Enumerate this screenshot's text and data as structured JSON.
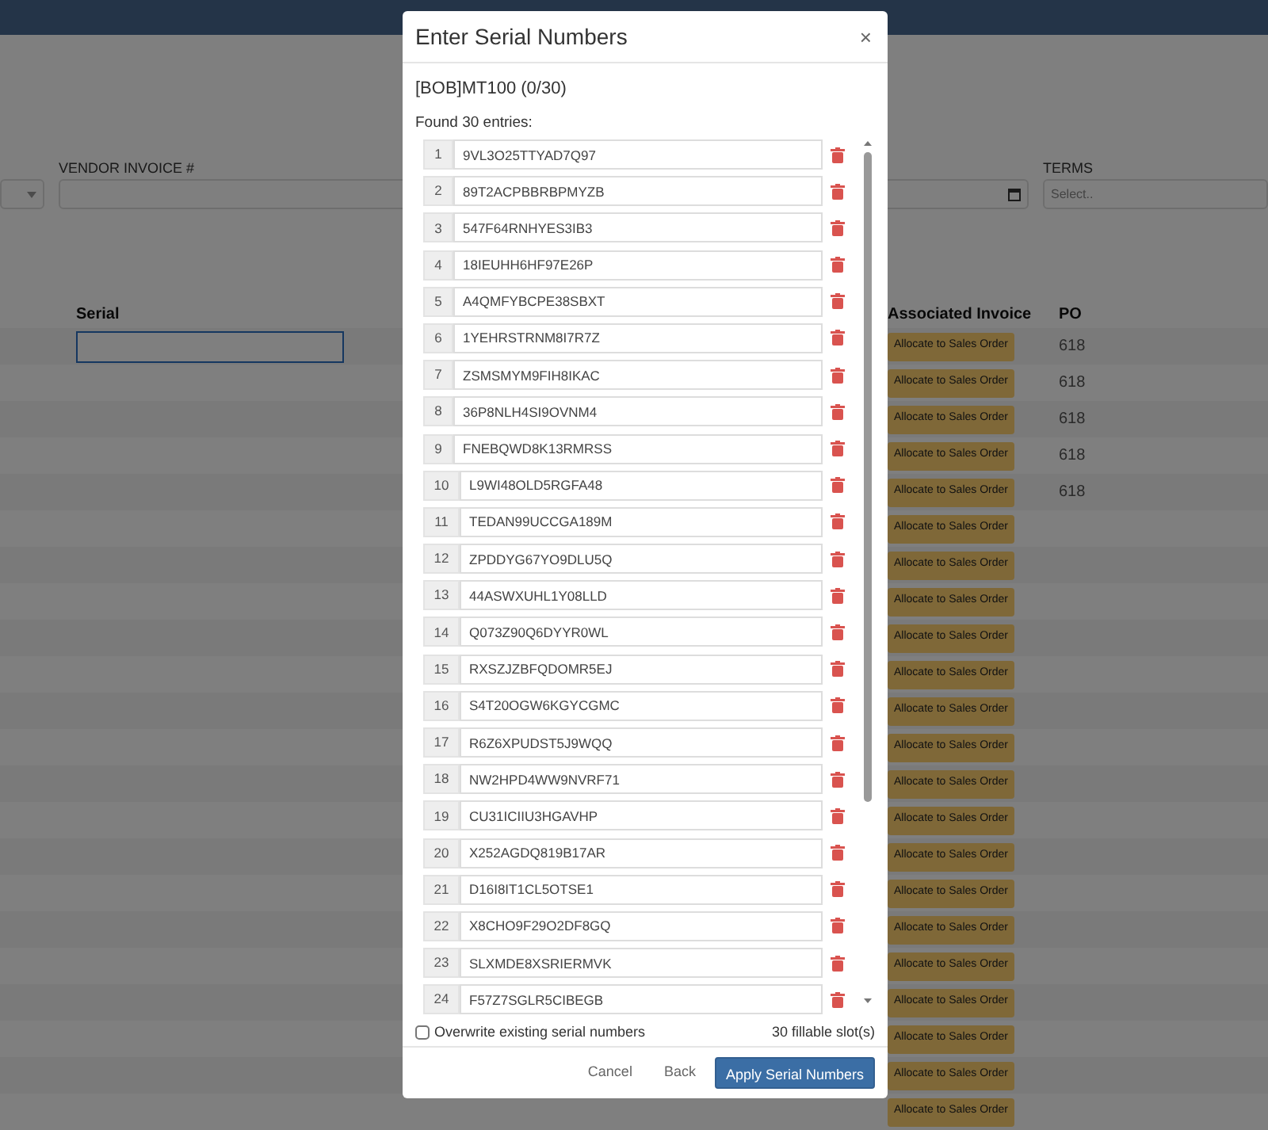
{
  "page": {
    "vendor_invoice_label": "VENDOR INVOICE #",
    "terms_label": "TERMS",
    "terms_placeholder": "Select..",
    "table": {
      "columns": [
        "Serial",
        "Associated Invoice",
        "PO"
      ],
      "rows": [
        {
          "action": "Allocate to Sales Order",
          "po": "618"
        },
        {
          "action": "Allocate to Sales Order",
          "po": "618"
        },
        {
          "action": "Allocate to Sales Order",
          "po": "618"
        },
        {
          "action": "Allocate to Sales Order",
          "po": "618"
        },
        {
          "action": "Allocate to Sales Order",
          "po": "618"
        },
        {
          "action": "Allocate to Sales Order"
        },
        {
          "action": "Allocate to Sales Order"
        },
        {
          "action": "Allocate to Sales Order"
        },
        {
          "action": "Allocate to Sales Order"
        },
        {
          "action": "Allocate to Sales Order"
        },
        {
          "action": "Allocate to Sales Order"
        },
        {
          "action": "Allocate to Sales Order"
        },
        {
          "action": "Allocate to Sales Order"
        },
        {
          "action": "Allocate to Sales Order"
        },
        {
          "action": "Allocate to Sales Order"
        },
        {
          "action": "Allocate to Sales Order"
        },
        {
          "action": "Allocate to Sales Order"
        },
        {
          "action": "Allocate to Sales Order"
        },
        {
          "action": "Allocate to Sales Order"
        },
        {
          "action": "Allocate to Sales Order"
        },
        {
          "action": "Allocate to Sales Order"
        },
        {
          "action": "Allocate to Sales Order"
        }
      ]
    }
  },
  "modal": {
    "title": "Enter Serial Numbers",
    "close": "×",
    "item": "[BOB]MT100 (0/30)",
    "found": "Found 30 entries:",
    "entries": [
      {
        "index": "1",
        "serial": "9VL3O25TTYAD7Q97"
      },
      {
        "index": "2",
        "serial": "89T2ACPBBRBPMYZB"
      },
      {
        "index": "3",
        "serial": "547F64RNHYES3IB3"
      },
      {
        "index": "4",
        "serial": "18IEUHH6HF97E26P"
      },
      {
        "index": "5",
        "serial": "A4QMFYBCPE38SBXT"
      },
      {
        "index": "6",
        "serial": "1YEHRSTRNM8I7R7Z"
      },
      {
        "index": "7",
        "serial": "ZSMSMYM9FIH8IKAC"
      },
      {
        "index": "8",
        "serial": "36P8NLH4SI9OVNM4"
      },
      {
        "index": "9",
        "serial": "FNEBQWD8K13RMRSS"
      },
      {
        "index": "10",
        "serial": "L9WI48OLD5RGFA48"
      },
      {
        "index": "11",
        "serial": "TEDAN99UCCGA189M"
      },
      {
        "index": "12",
        "serial": "ZPDDYG67YO9DLU5Q"
      },
      {
        "index": "13",
        "serial": "44ASWXUHL1Y08LLD"
      },
      {
        "index": "14",
        "serial": "Q073Z90Q6DYYR0WL"
      },
      {
        "index": "15",
        "serial": "RXSZJZBFQDOMR5EJ"
      },
      {
        "index": "16",
        "serial": "S4T20OGW6KGYCGMC"
      },
      {
        "index": "17",
        "serial": "R6Z6XPUDST5J9WQQ"
      },
      {
        "index": "18",
        "serial": "NW2HPD4WW9NVRF71"
      },
      {
        "index": "19",
        "serial": "CU31ICIIU3HGAVHP"
      },
      {
        "index": "20",
        "serial": "X252AGDQ819B17AR"
      },
      {
        "index": "21",
        "serial": "D16I8IT1CL5OTSE1"
      },
      {
        "index": "22",
        "serial": "X8CHO9F29O2DF8GQ"
      },
      {
        "index": "23",
        "serial": "SLXMDE8XSRIERMVK"
      },
      {
        "index": "24",
        "serial": "F57Z7SGLR5CIBEGB"
      }
    ],
    "overwrite": {
      "label": "Overwrite existing serial numbers",
      "checked": false
    },
    "slots": "30 fillable slot(s)",
    "buttons": [
      {
        "label": "Cancel",
        "kind": "link"
      },
      {
        "label": "Back",
        "kind": "link"
      },
      {
        "label": "Apply Serial Numbers",
        "kind": "primary"
      }
    ]
  }
}
